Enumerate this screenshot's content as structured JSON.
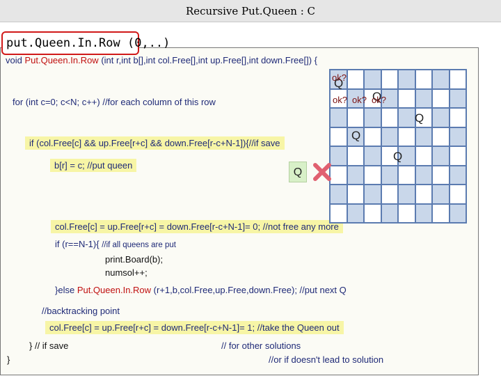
{
  "slide": {
    "title": "Recursive Put.Queen : C",
    "call_label": "put.Queen.In.Row (0,..)"
  },
  "code": {
    "signature_pre": "void ",
    "signature_fn": "Put.Queen.In.Row",
    "signature_post": " (int r,int b[],int col.Free[],int up.Free[],int down.Free[]) {",
    "for_loop": "for (int c=0; c<N; c++) //for each column of this row",
    "if_check": "if (col.Free[c] && up.Free[r+c] && down.Free[r-c+N-1]){//if save",
    "put_queen": "b[r] = c; //put queen",
    "mark_taken": "col.Free[c] = up.Free[r+c] = down.Free[r-c+N-1]= 0; //not free any more",
    "if_last_pre": "if (r==N-1){",
    "if_last_comment": "//if all queens are put",
    "print_board": "print.Board(b);",
    "numsol": "numsol++;",
    "else_pre": "}else ",
    "else_fn": "Put.Queen.In.Row",
    "else_post": " (r+1,b,col.Free,up.Free,down.Free); //put next Q",
    "backtrack_comment": "//backtracking point",
    "take_out": "col.Free[c] = up.Free[r+c] = down.Free[r-c+N-1]= 1; //take the Queen out",
    "close_if": "} // if save",
    "other_solutions": "// for other solutions",
    "close_fn": "}",
    "no_solution": "//or if doesn't lead to solution"
  },
  "board": {
    "size": 8,
    "queen_glyph": "Q",
    "ok_labels": {
      "row0": "ok?",
      "row1_a": "ok?",
      "row1_b": "ok?",
      "row1_c": "ok?"
    },
    "queens_placed": [
      {
        "row": 0,
        "col": 0
      },
      {
        "row": 1,
        "col": 2
      },
      {
        "row": 2,
        "col": 5
      },
      {
        "row": 3,
        "col": 1
      },
      {
        "row": 4,
        "col": 4
      }
    ],
    "moving_queen": "Q"
  },
  "colors": {
    "highlight": "#f7f5a6",
    "code_text": "#1f2a77",
    "function_red": "#c01010",
    "cell_blue": "#c9d7ea",
    "grid_line": "#5b7bb0",
    "call_border": "#d11919",
    "reject_mark": "#e06070"
  }
}
